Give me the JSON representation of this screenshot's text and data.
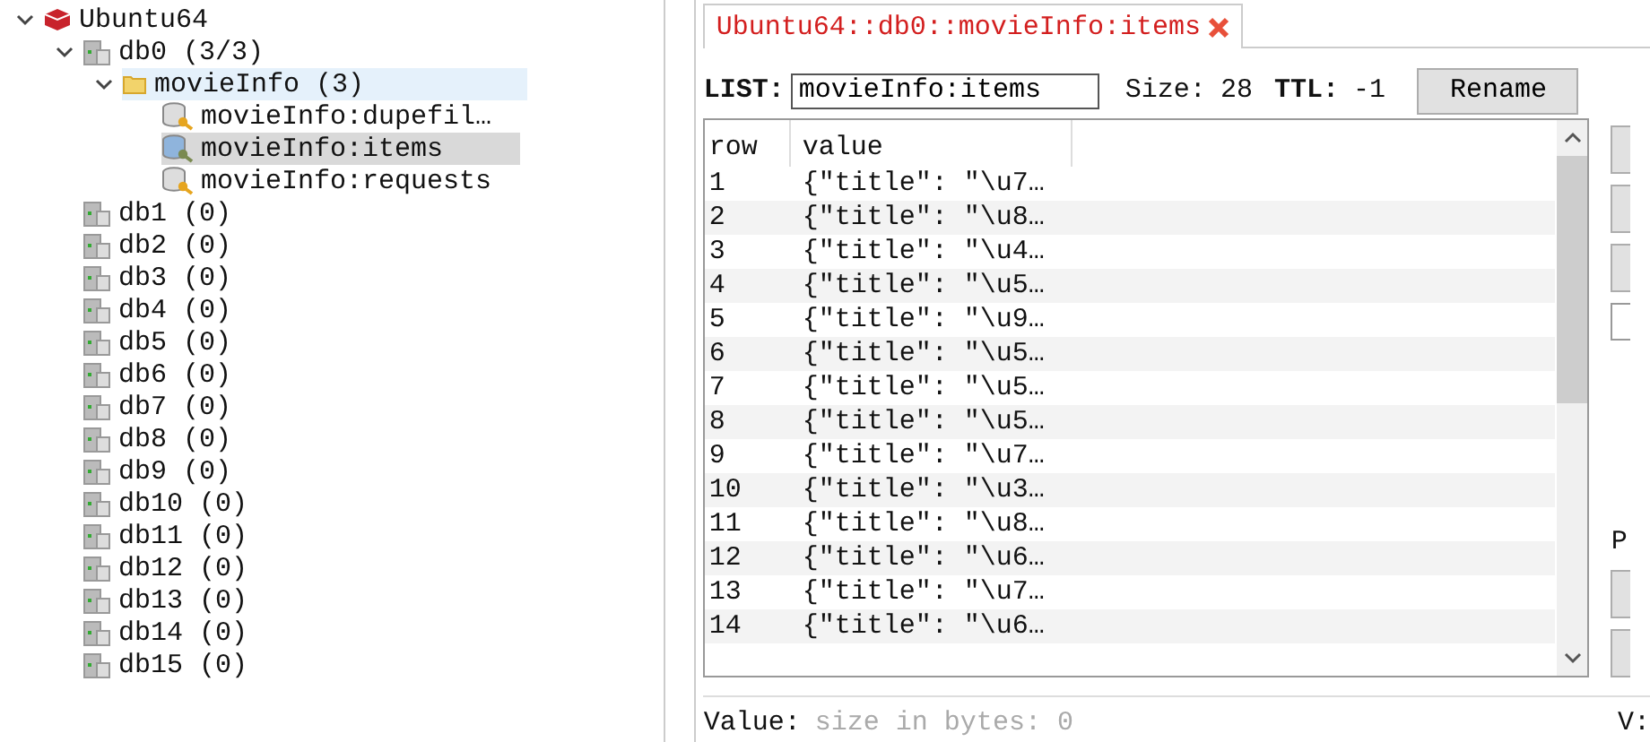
{
  "tree": [
    {
      "label": "Ubuntu64",
      "kind": "server",
      "expanded": true,
      "selected": false,
      "children": [
        {
          "label": "db0  (3/3)",
          "kind": "db",
          "expanded": true,
          "selected": false,
          "children": [
            {
              "label": "movieInfo (3)",
              "kind": "folder",
              "expanded": true,
              "selected": false,
              "hovered": true,
              "children": [
                {
                  "label": "movieInfo:dupefil…",
                  "kind": "key",
                  "selected": false
                },
                {
                  "label": "movieInfo:items",
                  "kind": "key",
                  "selected": true
                },
                {
                  "label": "movieInfo:requests",
                  "kind": "key",
                  "selected": false
                }
              ]
            }
          ]
        },
        {
          "label": "db1 (0)",
          "kind": "db",
          "selected": false
        },
        {
          "label": "db2 (0)",
          "kind": "db",
          "selected": false
        },
        {
          "label": "db3 (0)",
          "kind": "db",
          "selected": false
        },
        {
          "label": "db4 (0)",
          "kind": "db",
          "selected": false
        },
        {
          "label": "db5 (0)",
          "kind": "db",
          "selected": false
        },
        {
          "label": "db6 (0)",
          "kind": "db",
          "selected": false
        },
        {
          "label": "db7 (0)",
          "kind": "db",
          "selected": false
        },
        {
          "label": "db8 (0)",
          "kind": "db",
          "selected": false
        },
        {
          "label": "db9 (0)",
          "kind": "db",
          "selected": false
        },
        {
          "label": "db10 (0)",
          "kind": "db",
          "selected": false
        },
        {
          "label": "db11 (0)",
          "kind": "db",
          "selected": false
        },
        {
          "label": "db12 (0)",
          "kind": "db",
          "selected": false
        },
        {
          "label": "db13 (0)",
          "kind": "db",
          "selected": false
        },
        {
          "label": "db14 (0)",
          "kind": "db",
          "selected": false
        },
        {
          "label": "db15 (0)",
          "kind": "db",
          "selected": false
        }
      ]
    }
  ],
  "tabs": [
    {
      "label": "Ubuntu64::db0::movieInfo:items",
      "selected": true
    }
  ],
  "key_bar": {
    "type_label": "LIST:",
    "key_value": "movieInfo:items",
    "size_label": "Size:",
    "size": "28",
    "ttl_label": "TTL:",
    "ttl": "-1",
    "rename_button": "Rename"
  },
  "table": {
    "columns": [
      "row",
      "value"
    ],
    "rows": [
      [
        "1",
        "{\"title\": \"\\u7…"
      ],
      [
        "2",
        "{\"title\": \"\\u8…"
      ],
      [
        "3",
        "{\"title\": \"\\u4…"
      ],
      [
        "4",
        "{\"title\": \"\\u5…"
      ],
      [
        "5",
        "{\"title\": \"\\u9…"
      ],
      [
        "6",
        "{\"title\": \"\\u5…"
      ],
      [
        "7",
        "{\"title\": \"\\u5…"
      ],
      [
        "8",
        "{\"title\": \"\\u5…"
      ],
      [
        "9",
        "{\"title\": \"\\u7…"
      ],
      [
        "10",
        "{\"title\": \"\\u3…"
      ],
      [
        "11",
        "{\"title\": \"\\u8…"
      ],
      [
        "12",
        "{\"title\": \"\\u6…"
      ],
      [
        "13",
        "{\"title\": \"\\u7…"
      ],
      [
        "14",
        "{\"title\": \"\\u6…"
      ]
    ]
  },
  "side_labels": [
    "P",
    "V:"
  ],
  "value_bar": {
    "label": "Value:",
    "placeholder": "size in bytes: 0"
  }
}
